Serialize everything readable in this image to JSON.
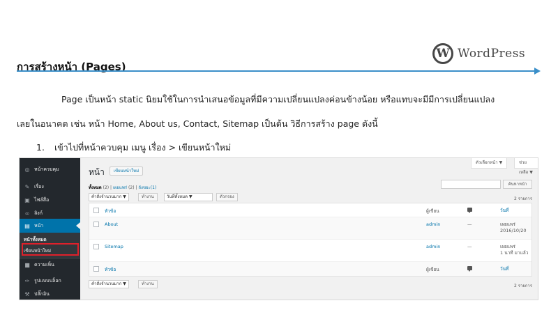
{
  "header": {
    "title": "การสร้างหน้า (Pages)",
    "logo_mark": "W",
    "logo_text": "WordPress"
  },
  "body": {
    "paragraph_line1": "Page เป็นหน้า static นิยมใช้ในการนำเสนอข้อมูลที่มีความเปลี่ยนแปลงค่อนข้างน้อย หรือแทบจะมีมีการเปลี่ยนแปลง",
    "paragraph_line2": "เลยในอนาคต เช่น หน้า Home, About us, Contact, Sitemap เป็นต้น วิธีการสร้าง page ดังนี้",
    "step_number": "1.",
    "step_text": "เข้าไปที่หน้าควบคุม  เมนู เรื่อง > เขียนหน้าใหม่"
  },
  "screenshot": {
    "sidebar": {
      "items": [
        {
          "icon": "dashboard-icon",
          "glyph": "◎",
          "label": "หน้าควบคุม"
        },
        {
          "icon": "pin-icon",
          "glyph": "✎",
          "label": "เรื่อง"
        },
        {
          "icon": "media-icon",
          "glyph": "▣",
          "label": "ไฟล์สื่อ"
        },
        {
          "icon": "link-icon",
          "glyph": "∞",
          "label": "ลิงก์"
        },
        {
          "icon": "page-icon",
          "glyph": "▤",
          "label": "หน้า"
        }
      ],
      "submenu": [
        {
          "label": "หน้าทั้งหมด"
        },
        {
          "label": "เขียนหน้าใหม่"
        }
      ],
      "items_after": [
        {
          "icon": "comment-icon",
          "glyph": "■",
          "label": "ความเห็น"
        },
        {
          "icon": "appearance-icon",
          "glyph": "✑",
          "label": "รูปแบบบล็อก"
        },
        {
          "icon": "plugin-icon",
          "glyph": "⚒",
          "label": "ปลั๊กอิน"
        }
      ]
    },
    "main": {
      "title": "หน้า",
      "add_new": "เขียนหน้าใหม่",
      "screen_options": "ตัวเลือกหน้า ▼",
      "help": "ช่วยเหลือ ▼",
      "views_all": "ทั้งหมด",
      "views_all_count": "(2)",
      "views_published": "เผยแพร่",
      "views_published_count": "(2)",
      "views_trash": "ถังขยะ",
      "views_trash_count": "(1)",
      "search_button": "ค้นหาหน้า",
      "bulk_action": "คำสั่งจำนวนมาก ▼",
      "apply": "ทำงาน",
      "date_filter": "วันที่ทั้งหมด      ▼",
      "filter": "ตัวกรอง",
      "item_count": "2 รายการ",
      "columns": {
        "title": "หัวข้อ",
        "author": "ผู้เขียน",
        "date": "วันที่"
      },
      "rows": [
        {
          "title": "About",
          "author": "admin",
          "comments": "—",
          "status": "เผยแพร่",
          "date": "2016/10/20"
        },
        {
          "title": "Sitemap",
          "author": "admin",
          "comments": "—",
          "status": "เผยแพร่",
          "date": "1 นาที มาแล้ว"
        }
      ]
    }
  }
}
